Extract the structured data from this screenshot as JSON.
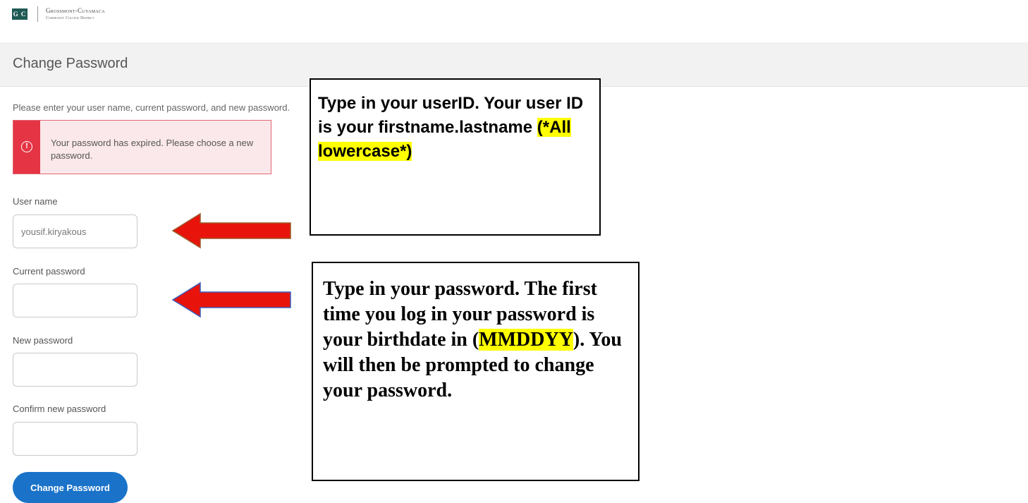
{
  "header": {
    "logo_mark": "G C",
    "logo_line1": "Grossmont-Cuyamaca",
    "logo_line2": "Community College District"
  },
  "page": {
    "title": "Change Password",
    "instructions": "Please enter your user name, current password, and new password."
  },
  "alert": {
    "icon": "exclamation-circle-icon",
    "message": "Your password has expired. Please choose a new password."
  },
  "form": {
    "username_label": "User name",
    "username_value": "yousif.kiryakous",
    "current_password_label": "Current password",
    "current_password_value": "",
    "new_password_label": "New password",
    "new_password_value": "",
    "confirm_password_label": "Confirm new password",
    "confirm_password_value": "",
    "submit_label": "Change Password"
  },
  "callouts": {
    "userid_text": "Type in your userID. Your user ID is your firstname.lastname ",
    "userid_highlight": "(*All lowercase*)",
    "password_text_pre": "Type in your password. The first time you log in your password is your birthdate in (",
    "password_highlight": "MMDDYY",
    "password_text_post": "). You will then be prompted to change your password."
  },
  "colors": {
    "primary_button": "#1a73c9",
    "alert_accent": "#e53545",
    "alert_background": "#fbe8ea",
    "arrow_fill": "#e8140c",
    "highlight": "#ffff00"
  }
}
